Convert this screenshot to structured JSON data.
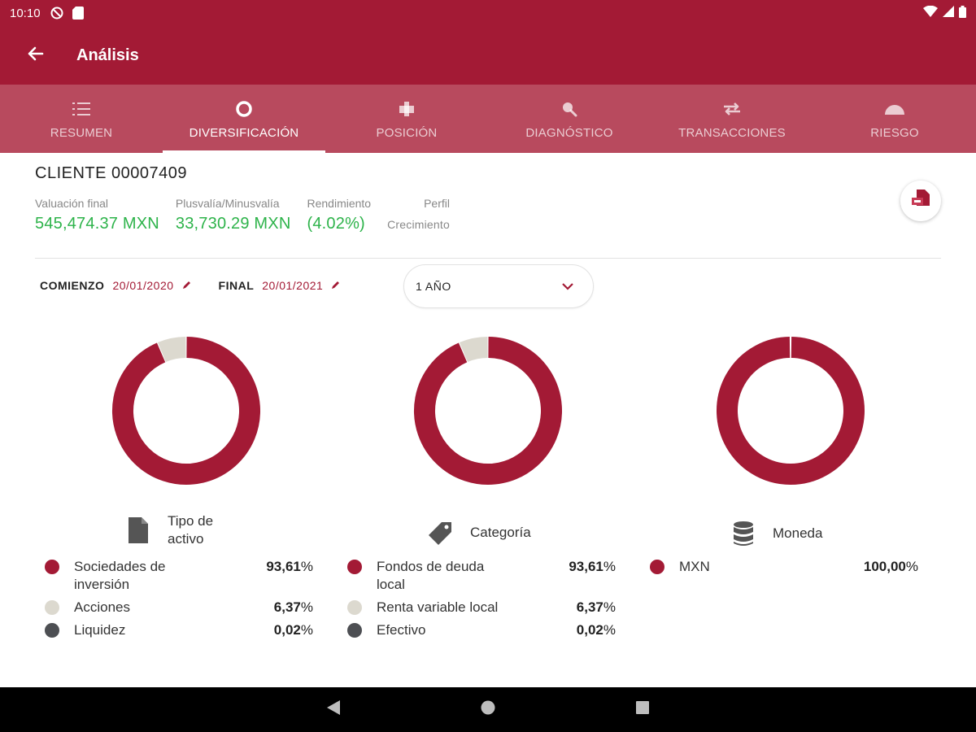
{
  "status_bar": {
    "time": "10:10"
  },
  "app_bar": {
    "title": "Análisis"
  },
  "tabs": [
    {
      "label": "RESUMEN",
      "icon": "list-icon",
      "active": false
    },
    {
      "label": "DIVERSIFICACIÓN",
      "icon": "donut-icon",
      "active": true
    },
    {
      "label": "POSICIÓN",
      "icon": "puzzle-icon",
      "active": false
    },
    {
      "label": "DIAGNÓSTICO",
      "icon": "magnifier-icon",
      "active": false
    },
    {
      "label": "TRANSACCIONES",
      "icon": "swap-arrows-icon",
      "active": false
    },
    {
      "label": "RIESGO",
      "icon": "gauge-icon",
      "active": false
    }
  ],
  "client": {
    "title": "CLIENTE 00007409"
  },
  "metrics": {
    "valuacion": {
      "label": "Valuación final",
      "value": "545,474.37 MXN"
    },
    "plusvalia": {
      "label": "Plusvalía/Minusvalía",
      "value": "33,730.29 MXN"
    },
    "rendimiento": {
      "label": "Rendimiento",
      "value": "(4.02%)"
    },
    "perfil": {
      "label": "Perfil",
      "value": "Crecimiento"
    }
  },
  "dates": {
    "start_label": "COMIENZO",
    "start_value": "20/01/2020",
    "end_label": "FINAL",
    "end_value": "20/01/2021"
  },
  "period": {
    "value": "1 AÑO"
  },
  "colors": {
    "primary": "#a31a35",
    "tabs_bg": "#b84a5e",
    "positive": "#2db34a",
    "slice_light": "#dcd9cf",
    "slice_dark": "#4d4f53"
  },
  "chart_data": [
    {
      "type": "pie",
      "title_line1": "Tipo de",
      "title_line2": "activo",
      "icon": "document-icon",
      "slices": [
        {
          "name_line1": "Sociedades de",
          "name_line2": "inversión",
          "value": 93.61,
          "label": "93,61",
          "color": "#a31a35"
        },
        {
          "name_line1": "Acciones",
          "name_line2": "",
          "value": 6.37,
          "label": "6,37",
          "color": "#dcd9cf"
        },
        {
          "name_line1": "Liquidez",
          "name_line2": "",
          "value": 0.02,
          "label": "0,02",
          "color": "#4d4f53"
        }
      ]
    },
    {
      "type": "pie",
      "title_line1": "Categoría",
      "title_line2": "",
      "icon": "tag-icon",
      "slices": [
        {
          "name_line1": "Fondos de deuda",
          "name_line2": "local",
          "value": 93.61,
          "label": "93,61",
          "color": "#a31a35"
        },
        {
          "name_line1": "Renta variable local",
          "name_line2": "",
          "value": 6.37,
          "label": "6,37",
          "color": "#dcd9cf"
        },
        {
          "name_line1": "Efectivo",
          "name_line2": "",
          "value": 0.02,
          "label": "0,02",
          "color": "#4d4f53"
        }
      ]
    },
    {
      "type": "pie",
      "title_line1": "Moneda",
      "title_line2": "",
      "icon": "database-icon",
      "slices": [
        {
          "name_line1": "MXN",
          "name_line2": "",
          "value": 100.0,
          "label": "100,00",
          "color": "#a31a35"
        }
      ]
    }
  ]
}
